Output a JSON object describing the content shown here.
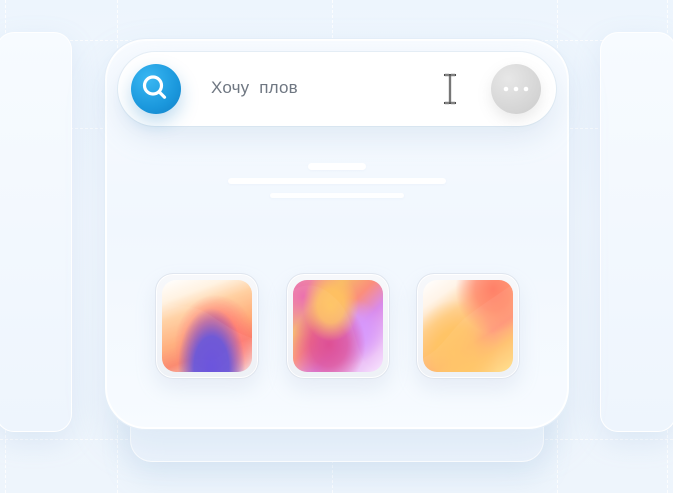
{
  "search": {
    "value": "Хочу  плов"
  },
  "colors": {
    "background": "#eef5fc",
    "search_button": "#1a97dc",
    "more_button": "#d4d4d4",
    "search_text": "#6f7782"
  },
  "icons": {
    "search": "search-icon",
    "text_cursor": "text-cursor-icon",
    "more": "more-options-icon"
  },
  "thumbnails": [
    {
      "name": "thumbnail-1"
    },
    {
      "name": "thumbnail-2"
    },
    {
      "name": "thumbnail-3"
    }
  ]
}
